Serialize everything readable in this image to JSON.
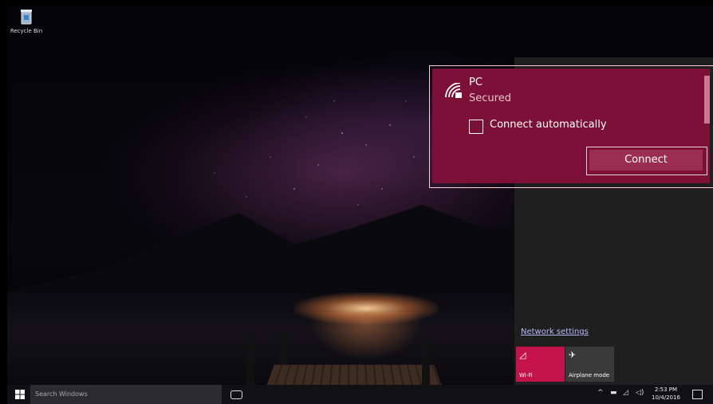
{
  "desktop": {
    "recycle_bin_label": "Recycle Bin"
  },
  "network_popup": {
    "network_name": "PC",
    "network_status": "Secured",
    "connect_auto_label": "Connect automatically",
    "connect_auto_checked": false,
    "connect_button_label": "Connect"
  },
  "network_panel": {
    "settings_link": "Network settings",
    "tiles": [
      {
        "label": "Wi-Fi",
        "icon": "wifi-icon",
        "active": true
      },
      {
        "label": "Airplane mode",
        "icon": "airplane-icon",
        "active": false
      }
    ]
  },
  "taskbar": {
    "search_placeholder": "Search Windows",
    "time": "2:53 PM",
    "date": "10/4/2016"
  },
  "colors": {
    "accent": "#c4124a",
    "popup_bg": "#7c1036",
    "panel_bg": "#1f1f1f"
  }
}
